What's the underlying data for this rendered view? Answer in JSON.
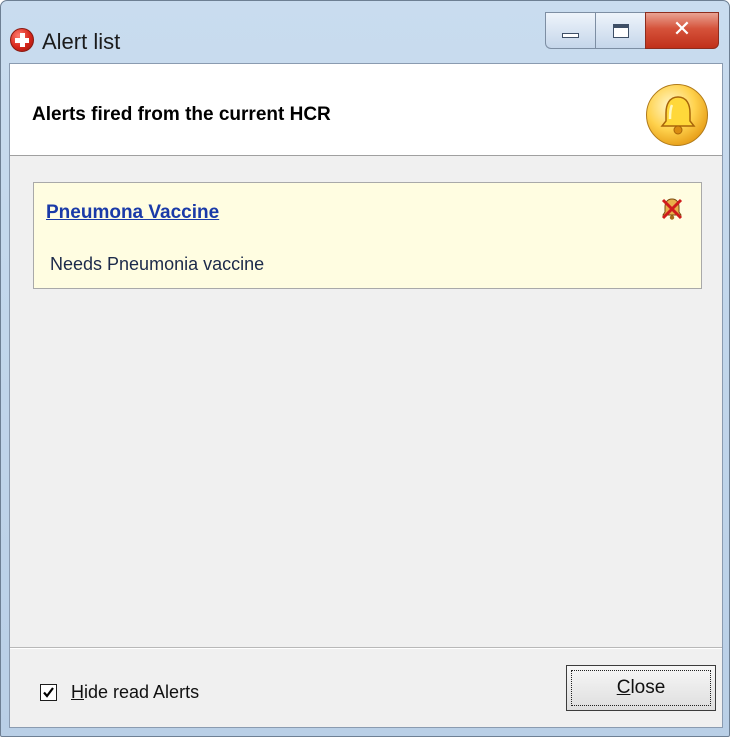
{
  "window": {
    "title": "Alert list",
    "icon": "red-cross-icon",
    "buttons": {
      "minimize": "minimize-icon",
      "maximize": "maximize-icon",
      "close": "close-icon"
    }
  },
  "header": {
    "title": "Alerts fired from the current HCR",
    "icon": "bell-icon"
  },
  "alerts": [
    {
      "title": "Pneumona Vaccine",
      "description": "Needs Pneumonia vaccine",
      "action_icon": "no-bell-icon"
    }
  ],
  "footer": {
    "hide_read_checkbox": {
      "checked": true,
      "label_underlined": "H",
      "label_rest": "ide read Alerts"
    },
    "close_button": {
      "label_underlined": "C",
      "label_rest": "lose"
    }
  },
  "colors": {
    "alert_background": "#fffde1",
    "link": "#1a3aa8",
    "client_background": "#f0f0f0"
  }
}
